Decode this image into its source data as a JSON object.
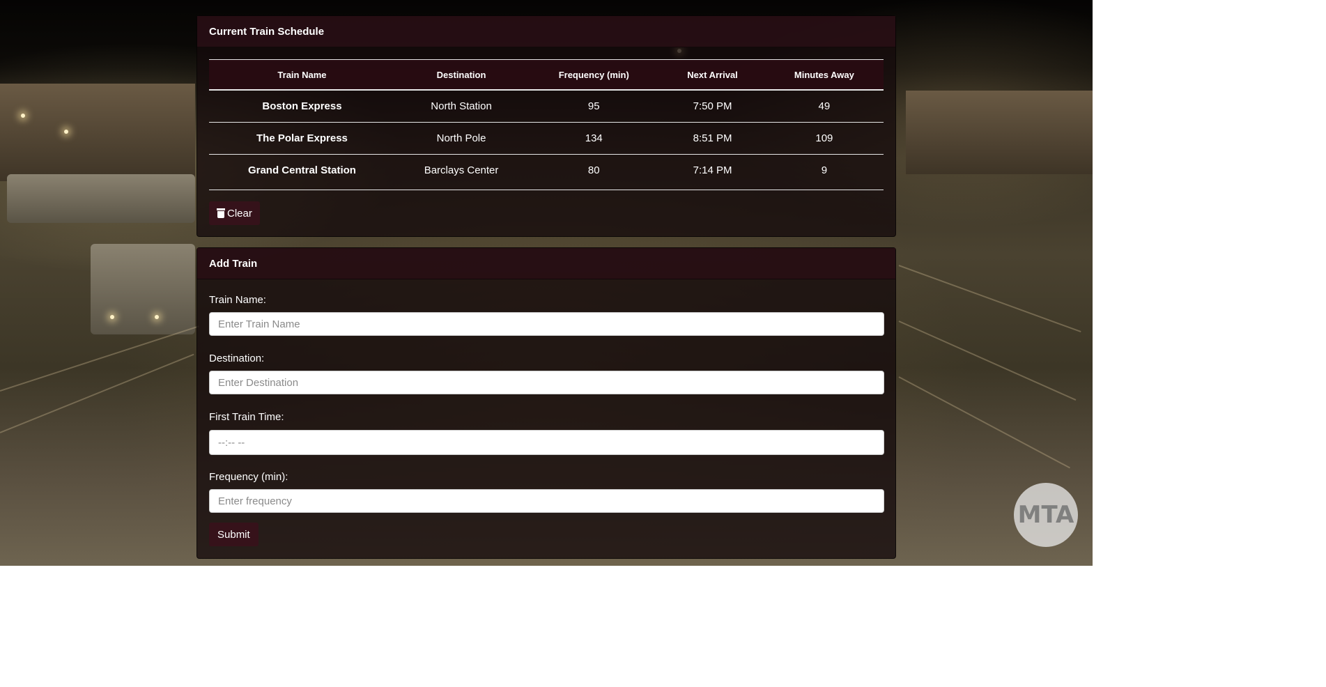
{
  "schedule": {
    "title": "Current Train Schedule",
    "columns": [
      "Train Name",
      "Destination",
      "Frequency (min)",
      "Next Arrival",
      "Minutes Away"
    ],
    "rows": [
      [
        "Boston Express",
        "North Station",
        "95",
        "7:50 PM",
        "49"
      ],
      [
        "The Polar Express",
        "North Pole",
        "134",
        "8:51 PM",
        "109"
      ],
      [
        "Grand Central Station",
        "Barclays Center",
        "80",
        "7:14 PM",
        "9"
      ]
    ],
    "clear_label": "Clear"
  },
  "add_train": {
    "title": "Add Train",
    "fields": {
      "train_name": {
        "label": "Train Name:",
        "placeholder": "Enter Train Name",
        "value": ""
      },
      "destination": {
        "label": "Destination:",
        "placeholder": "Enter Destination",
        "value": ""
      },
      "first_train_time": {
        "label": "First Train Time:",
        "placeholder": "--:-- --",
        "value": ""
      },
      "frequency": {
        "label": "Frequency (min):",
        "placeholder": "Enter frequency",
        "value": ""
      }
    },
    "submit_label": "Submit"
  },
  "background": {
    "logo_text": "MTA"
  },
  "colors": {
    "panel_heading": "#280e14",
    "button": "#37121a",
    "rule": "#e8e8e8"
  }
}
